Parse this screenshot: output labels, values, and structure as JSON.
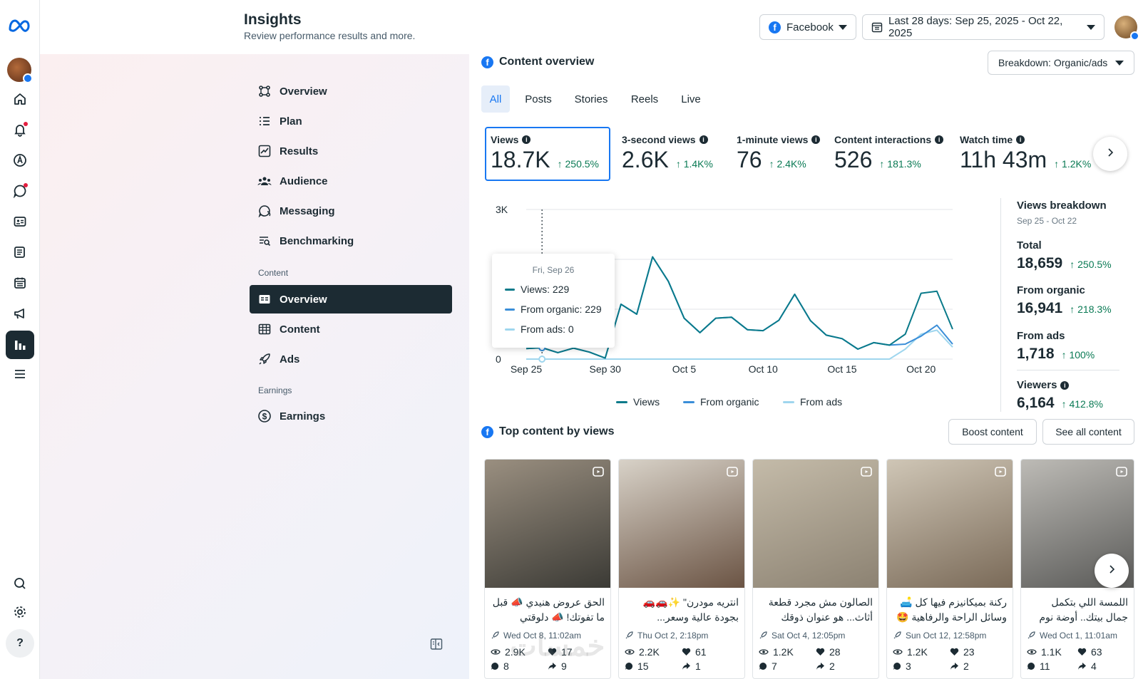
{
  "header": {
    "title": "Insights",
    "subtitle": "Review performance results and more.",
    "platform": "Facebook",
    "date_range": "Last 28 days: Sep 25, 2025 - Oct 22, 2025"
  },
  "nav": {
    "items": [
      {
        "label": "Overview",
        "icon": "overview-icon"
      },
      {
        "label": "Plan",
        "icon": "plan-icon"
      },
      {
        "label": "Results",
        "icon": "results-icon"
      },
      {
        "label": "Audience",
        "icon": "audience-icon"
      },
      {
        "label": "Messaging",
        "icon": "messaging-icon"
      },
      {
        "label": "Benchmarking",
        "icon": "benchmarking-icon"
      }
    ],
    "content_section": "Content",
    "content_items": [
      {
        "label": "Overview",
        "icon": "content-overview-icon",
        "active": true
      },
      {
        "label": "Content",
        "icon": "table-icon"
      },
      {
        "label": "Ads",
        "icon": "rocket-icon"
      }
    ],
    "earnings_section": "Earnings",
    "earnings_items": [
      {
        "label": "Earnings",
        "icon": "dollar-icon"
      }
    ]
  },
  "content_overview": {
    "title": "Content overview",
    "breakdown": "Breakdown: Organic/ads",
    "tabs": [
      "All",
      "Posts",
      "Stories",
      "Reels",
      "Live"
    ],
    "metrics": [
      {
        "label": "Views",
        "value": "18.7K",
        "change": "250.5%"
      },
      {
        "label": "3-second views",
        "value": "2.6K",
        "change": "1.4K%"
      },
      {
        "label": "1-minute views",
        "value": "76",
        "change": "2.4K%"
      },
      {
        "label": "Content interactions",
        "value": "526",
        "change": "181.3%"
      },
      {
        "label": "Watch time",
        "value": "11h 43m",
        "change": "1.2K%"
      }
    ]
  },
  "chart_data": {
    "type": "line",
    "x": [
      "Sep 25",
      "Sep 26",
      "Sep 27",
      "Sep 28",
      "Sep 29",
      "Sep 30",
      "Oct 1",
      "Oct 2",
      "Oct 3",
      "Oct 4",
      "Oct 5",
      "Oct 6",
      "Oct 7",
      "Oct 8",
      "Oct 9",
      "Oct 10",
      "Oct 11",
      "Oct 12",
      "Oct 13",
      "Oct 14",
      "Oct 15",
      "Oct 16",
      "Oct 17",
      "Oct 18",
      "Oct 19",
      "Oct 20",
      "Oct 21",
      "Oct 22"
    ],
    "x_tick_labels": [
      "Sep 25",
      "Sep 30",
      "Oct 5",
      "Oct 10",
      "Oct 15",
      "Oct 20"
    ],
    "y_tick_labels": [
      "3K",
      "0"
    ],
    "ylim": [
      0,
      3000
    ],
    "series": [
      {
        "name": "Views",
        "color": "#0a7a8a",
        "values": [
          210,
          229,
          130,
          220,
          140,
          20,
          1100,
          900,
          2050,
          1560,
          820,
          530,
          820,
          840,
          590,
          570,
          780,
          1300,
          770,
          480,
          410,
          200,
          330,
          280,
          500,
          1320,
          1360,
          600
        ]
      },
      {
        "name": "From organic",
        "color": "#3a8ed8",
        "values": [
          210,
          229,
          130,
          220,
          140,
          20,
          1100,
          900,
          2050,
          1560,
          820,
          530,
          820,
          840,
          590,
          570,
          780,
          1300,
          770,
          480,
          410,
          200,
          330,
          280,
          300,
          460,
          680,
          300
        ]
      },
      {
        "name": "From ads",
        "color": "#9fd6ee",
        "values": [
          0,
          0,
          0,
          0,
          0,
          0,
          0,
          0,
          0,
          0,
          0,
          0,
          0,
          0,
          0,
          0,
          0,
          0,
          0,
          0,
          0,
          0,
          0,
          0,
          200,
          500,
          580,
          240
        ]
      }
    ],
    "tooltip": {
      "date": "Fri, Sep 26",
      "rows": [
        "Views: 229",
        "From organic: 229",
        "From ads: 0"
      ]
    }
  },
  "breakdown": {
    "title": "Views breakdown",
    "range": "Sep 25 - Oct 22",
    "rows": [
      {
        "label": "Total",
        "value": "18,659",
        "change": "250.5%"
      },
      {
        "label": "From organic",
        "value": "16,941",
        "change": "218.3%"
      },
      {
        "label": "From ads",
        "value": "1,718",
        "change": "100%"
      },
      {
        "label": "Viewers",
        "value": "6,164",
        "change": "412.8%"
      }
    ]
  },
  "top_content": {
    "title": "Top content by views",
    "boost": "Boost content",
    "see_all": "See all content",
    "cards": [
      {
        "caption": "الحق عروض هنيدي 📣 قبل ما تفوتك! 📣 دلوقتي",
        "date": "Wed Oct 8, 11:02am",
        "views": "2.9K",
        "likes": "17",
        "comments": "8",
        "shares": "9",
        "colors": [
          "#3b3a35",
          "#9a8f80"
        ]
      },
      {
        "caption": "انتريه مودرن\" ✨🚗🚗 بجودة عالية وسعر...",
        "date": "Thu Oct 2, 2:18pm",
        "views": "2.2K",
        "likes": "61",
        "comments": "15",
        "shares": "1",
        "colors": [
          "#6b5444",
          "#d8d2c8"
        ]
      },
      {
        "caption": "الصالون مش مجرد قطعة أثاث... هو عنوان ذوقك",
        "date": "Sat Oct 4, 12:05pm",
        "views": "1.2K",
        "likes": "28",
        "comments": "7",
        "shares": "2",
        "colors": [
          "#8c8272",
          "#c4bba9"
        ]
      },
      {
        "caption": "ركنة بميكانيزم فيها كل 🛋️ وسائل الراحة والرفاهية 🤩",
        "date": "Sun Oct 12, 12:58pm",
        "views": "1.2K",
        "likes": "23",
        "comments": "3",
        "shares": "2",
        "colors": [
          "#7a6a58",
          "#cfc6b6"
        ]
      },
      {
        "caption": "اللمسة اللي بتكمل جمال بيتك.. أوضة نوم ماستر",
        "date": "Wed Oct 1, 11:01am",
        "views": "1.1K",
        "likes": "63",
        "comments": "11",
        "shares": "4",
        "colors": [
          "#5a5a58",
          "#bdbbb6"
        ]
      }
    ]
  },
  "watermark": "خمسات"
}
